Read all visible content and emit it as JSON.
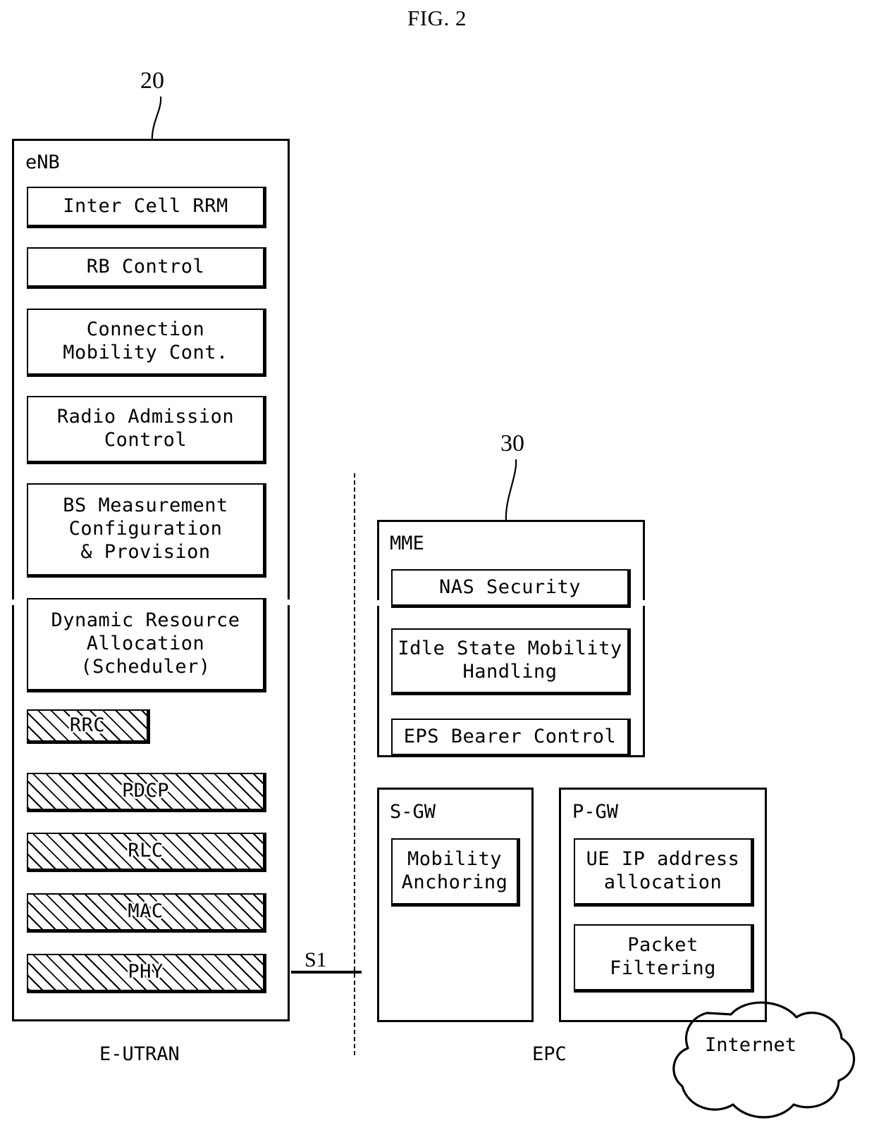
{
  "figure": {
    "title": "FIG. 2"
  },
  "reference_numerals": {
    "enb": "20",
    "mme": "30"
  },
  "enb": {
    "label": "eNB",
    "modules": [
      {
        "text": "Inter Cell RRM",
        "hatched": false
      },
      {
        "text": "RB Control",
        "hatched": false
      },
      {
        "text": "Connection\nMobility Cont.",
        "hatched": false
      },
      {
        "text": "Radio Admission\nControl",
        "hatched": false
      },
      {
        "text": "BS Measurement\nConfiguration\n& Provision",
        "hatched": false
      },
      {
        "text": "Dynamic Resource\nAllocation\n(Scheduler)",
        "hatched": false
      },
      {
        "text": "RRC",
        "hatched": true
      },
      {
        "text": "PDCP",
        "hatched": true
      },
      {
        "text": "RLC",
        "hatched": true
      },
      {
        "text": "MAC",
        "hatched": true
      },
      {
        "text": "PHY",
        "hatched": true
      }
    ]
  },
  "mme": {
    "label": "MME",
    "modules": [
      {
        "text": "NAS Security"
      },
      {
        "text": "Idle State Mobility\nHandling"
      },
      {
        "text": "EPS Bearer Control"
      }
    ]
  },
  "sgw": {
    "label": "S-GW",
    "modules": [
      {
        "text": "Mobility\nAnchoring"
      }
    ]
  },
  "pgw": {
    "label": "P-GW",
    "modules": [
      {
        "text": "UE IP address\nallocation"
      },
      {
        "text": "Packet\nFiltering"
      }
    ]
  },
  "interface": {
    "s1": "S1"
  },
  "captions": {
    "eutran": "E-UTRAN",
    "epc": "EPC",
    "internet": "Internet"
  },
  "colors": {
    "stroke": "#000000",
    "background": "#ffffff"
  }
}
